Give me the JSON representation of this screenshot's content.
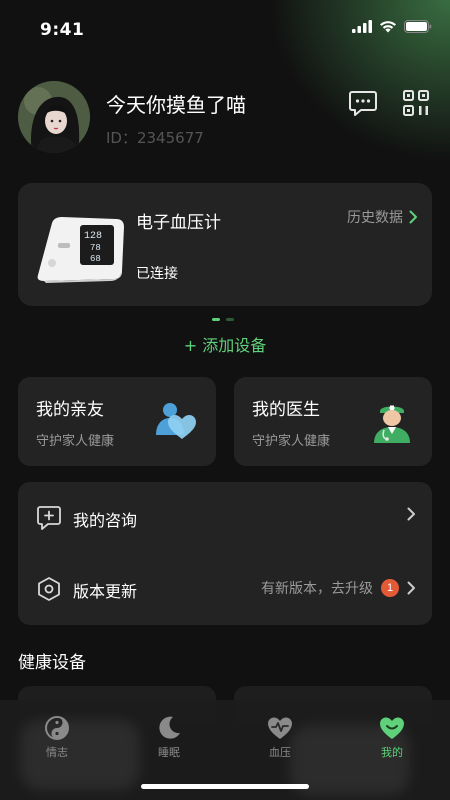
{
  "status_bar": {
    "time": "9:41"
  },
  "profile": {
    "name": "今天你摸鱼了喵",
    "id_text": "ID：2345677"
  },
  "device_card": {
    "name": "电子血压计",
    "status": "已连接",
    "history_label": "历史数据",
    "screen_readings": [
      "128",
      "78",
      "68"
    ]
  },
  "add_device_label": "+ 添加设备",
  "family_card": {
    "title": "我的亲友",
    "subtitle": "守护家人健康"
  },
  "doctor_card": {
    "title": "我的医生",
    "subtitle": "守护家人健康"
  },
  "list": {
    "consult_label": "我的咨询",
    "update_label": "版本更新",
    "update_hint": "有新版本，去升级",
    "update_badge": "1"
  },
  "section_title": "健康设备",
  "tabs": [
    {
      "label": "情志",
      "icon": "yin-yang-icon"
    },
    {
      "label": "睡眠",
      "icon": "moon-icon"
    },
    {
      "label": "血压",
      "icon": "heart-pulse-icon"
    },
    {
      "label": "我的",
      "icon": "heart-smile-icon"
    }
  ],
  "colors": {
    "accent": "#5fd17a",
    "card": "#232323",
    "background": "#111111",
    "badge": "#e35a36"
  }
}
